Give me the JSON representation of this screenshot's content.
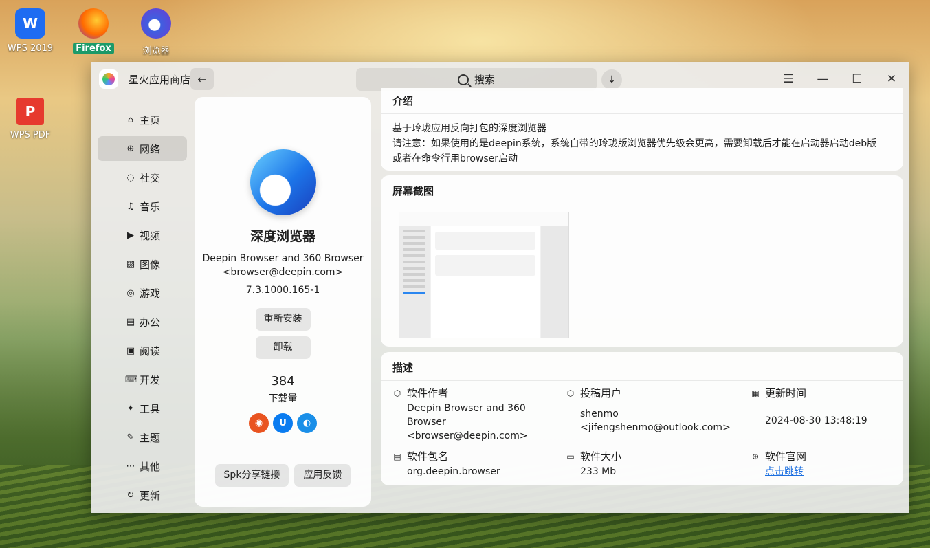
{
  "desktop": {
    "icons": [
      {
        "label": "WPS 2019"
      },
      {
        "label": "Firefox"
      },
      {
        "label": "浏览器"
      },
      {
        "label": "WPS PDF"
      }
    ]
  },
  "window": {
    "title": "星火应用商店",
    "search_label": "搜索",
    "back_glyph": "←",
    "download_glyph": "↓",
    "controls": {
      "menu": "☰",
      "minimize": "—",
      "maximize": "☐",
      "close": "✕"
    }
  },
  "sidebar": {
    "items": [
      {
        "label": "主页",
        "icon": "⌂"
      },
      {
        "label": "网络",
        "icon": "⊕"
      },
      {
        "label": "社交",
        "icon": "◌"
      },
      {
        "label": "音乐",
        "icon": "♫"
      },
      {
        "label": "视频",
        "icon": "▶"
      },
      {
        "label": "图像",
        "icon": "▨"
      },
      {
        "label": "游戏",
        "icon": "◎"
      },
      {
        "label": "办公",
        "icon": "▤"
      },
      {
        "label": "阅读",
        "icon": "▣"
      },
      {
        "label": "开发",
        "icon": "⌨"
      },
      {
        "label": "工具",
        "icon": "✦"
      },
      {
        "label": "主题",
        "icon": "✎"
      },
      {
        "label": "其他",
        "icon": "⋯"
      },
      {
        "label": "更新",
        "icon": "↻"
      }
    ],
    "active_index": 1
  },
  "detail": {
    "name": "深度浏览器",
    "authors_line1": "Deepin Browser and 360 Browser",
    "authors_line2": "<browser@deepin.com>",
    "version": "7.3.1000.165-1",
    "reinstall_label": "重新安装",
    "uninstall_label": "卸载",
    "download_count": "384",
    "download_label": "下载量",
    "share_label": "Spk分享链接",
    "feedback_label": "应用反馈",
    "distro_badges": [
      {
        "icon": "ubuntu-icon",
        "color": "#e95420",
        "glyph": "◉"
      },
      {
        "icon": "uos-icon",
        "color": "#0a7cf0",
        "glyph": "U"
      },
      {
        "icon": "deepin-icon",
        "color": "#1a8fe8",
        "glyph": "◐"
      }
    ]
  },
  "intro": {
    "heading": "介绍",
    "line1": "基于玲珑应用反向打包的深度浏览器",
    "line2": "请注意：如果使用的是deepin系统，系统自带的玲珑版浏览器优先级会更高，需要卸载后才能在启动器启动deb版",
    "line3": "或者在命令行用browser启动"
  },
  "screenshots": {
    "heading": "屏幕截图"
  },
  "description": {
    "heading": "描述",
    "author_key": "软件作者",
    "author_val1": "Deepin Browser and 360",
    "author_val2": "Browser",
    "author_val3": "<browser@deepin.com>",
    "uploader_key": "投稿用户",
    "uploader_val1": "shenmo",
    "uploader_val2": "<jifengshenmo@outlook.com>",
    "updated_key": "更新时间",
    "updated_val": "2024-08-30 13:48:19",
    "package_key": "软件包名",
    "package_val": "org.deepin.browser",
    "size_key": "软件大小",
    "size_val": "233 Mb",
    "website_key": "软件官网",
    "website_val": "点击跳转"
  }
}
